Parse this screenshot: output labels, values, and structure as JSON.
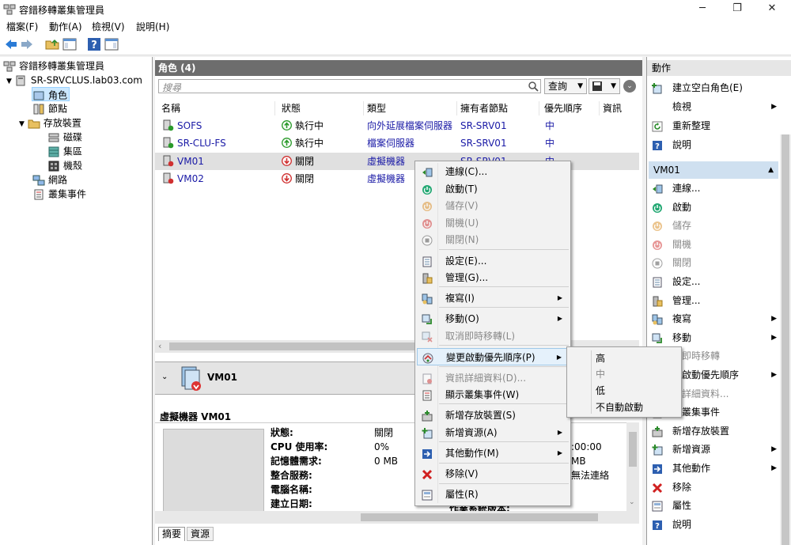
{
  "window": {
    "title": "容錯移轉叢集管理員"
  },
  "menubar": {
    "items": [
      "檔案(F)",
      "動作(A)",
      "檢視(V)",
      "說明(H)"
    ]
  },
  "tree": {
    "root": "容錯移轉叢集管理員",
    "cluster": "SR-SRVCLUS.lab03.com",
    "roles": "角色",
    "nodes": "節點",
    "storage": "存放裝置",
    "disks": "磁碟",
    "pools": "集區",
    "enclosures": "機殼",
    "networks": "網路",
    "events": "叢集事件"
  },
  "center": {
    "header": "角色 (4)",
    "search_placeholder": "搜尋",
    "query_button": "查詢",
    "columns": [
      "名稱",
      "狀態",
      "類型",
      "擁有者節點",
      "優先順序",
      "資訊"
    ],
    "rows": [
      {
        "name": "SOFS",
        "status": "執行中",
        "type": "向外延展檔案伺服器",
        "owner": "SR-SRV01",
        "priority": "中",
        "state": "running"
      },
      {
        "name": "SR-CLU-FS",
        "status": "執行中",
        "type": "檔案伺服器",
        "owner": "SR-SRV01",
        "priority": "中",
        "state": "running"
      },
      {
        "name": "VM01",
        "status": "關閉",
        "type": "虛擬機器",
        "owner": "SR-SRV01",
        "priority": "中",
        "state": "off"
      },
      {
        "name": "VM02",
        "status": "關閉",
        "type": "虛擬機器",
        "owner": "",
        "priority": "",
        "state": "off"
      }
    ],
    "detail": {
      "title": "VM01",
      "section": "虛擬機器 VM01",
      "labels": [
        "狀態:",
        "CPU 使用率:",
        "記憶體需求:",
        "整合服務:",
        "電腦名稱:",
        "建立日期:"
      ],
      "values": [
        "關閉",
        "0%",
        "0 MB",
        "",
        "",
        ""
      ],
      "right_values": [
        ":00:00",
        "MB",
        "無法連絡"
      ],
      "partial_label": "作業系統版本:",
      "tabs": [
        "摘要",
        "資源"
      ]
    }
  },
  "context_menu": {
    "items": [
      {
        "label": "連線(C)...",
        "icon": "connect-icon",
        "disabled": false,
        "submenu": false
      },
      {
        "label": "啟動(T)",
        "icon": "start-icon",
        "disabled": false,
        "submenu": false
      },
      {
        "label": "儲存(V)",
        "icon": "save-icon",
        "disabled": true,
        "submenu": false
      },
      {
        "label": "關機(U)",
        "icon": "shutdown-icon",
        "disabled": true,
        "submenu": false
      },
      {
        "label": "關閉(N)",
        "icon": "turn-off-icon",
        "disabled": true,
        "submenu": false
      },
      {
        "label": "設定(E)...",
        "icon": "settings-icon",
        "disabled": false,
        "submenu": false
      },
      {
        "label": "管理(G)...",
        "icon": "manage-icon",
        "disabled": false,
        "submenu": false
      },
      {
        "label": "複寫(I)",
        "icon": "replicate-icon",
        "disabled": false,
        "submenu": true
      },
      {
        "label": "移動(O)",
        "icon": "move-icon",
        "disabled": false,
        "submenu": true
      },
      {
        "label": "取消即時移轉(L)",
        "icon": "cancel-migration-icon",
        "disabled": true,
        "submenu": false
      },
      {
        "label": "變更啟動優先順序(P)",
        "icon": "priority-icon",
        "disabled": false,
        "submenu": true
      },
      {
        "label": "資訊詳細資料(D)...",
        "icon": "info-details-icon",
        "disabled": true,
        "submenu": false
      },
      {
        "label": "顯示叢集事件(W)",
        "icon": "events-icon",
        "disabled": false,
        "submenu": false
      },
      {
        "label": "新增存放裝置(S)",
        "icon": "add-storage-icon",
        "disabled": false,
        "submenu": false
      },
      {
        "label": "新增資源(A)",
        "icon": "add-resource-icon",
        "disabled": false,
        "submenu": true
      },
      {
        "label": "其他動作(M)",
        "icon": "more-actions-icon",
        "disabled": false,
        "submenu": true
      },
      {
        "label": "移除(V)",
        "icon": "remove-icon",
        "disabled": false,
        "submenu": false
      },
      {
        "label": "屬性(R)",
        "icon": "properties-icon",
        "disabled": false,
        "submenu": false
      }
    ]
  },
  "priority_submenu": {
    "items": [
      "高",
      "中",
      "低",
      "不自動啟動"
    ]
  },
  "actions": {
    "header": "動作",
    "general": [
      {
        "label": "建立空白角色(E)",
        "icon": "create-role-icon",
        "arrow": false
      },
      {
        "label": "檢視",
        "icon": "",
        "arrow": true
      },
      {
        "label": "重新整理",
        "icon": "refresh-icon",
        "arrow": false
      },
      {
        "label": "說明",
        "icon": "help-icon",
        "arrow": false
      }
    ],
    "vm_header": "VM01",
    "vm": [
      {
        "label": "連線...",
        "disabled": false,
        "arrow": false
      },
      {
        "label": "啟動",
        "disabled": false,
        "arrow": false
      },
      {
        "label": "儲存",
        "disabled": true,
        "arrow": false
      },
      {
        "label": "關機",
        "disabled": true,
        "arrow": false
      },
      {
        "label": "關閉",
        "disabled": true,
        "arrow": false
      },
      {
        "label": "設定...",
        "disabled": false,
        "arrow": false
      },
      {
        "label": "管理...",
        "disabled": false,
        "arrow": false
      },
      {
        "label": "複寫",
        "disabled": false,
        "arrow": true
      },
      {
        "label": "移動",
        "disabled": false,
        "arrow": true
      },
      {
        "label": "消即時移轉",
        "disabled": true,
        "arrow": false
      },
      {
        "label": "更啟動優先順序",
        "disabled": false,
        "arrow": true
      },
      {
        "label": "訊詳細資料...",
        "disabled": true,
        "arrow": false
      },
      {
        "label": "示叢集事件",
        "disabled": false,
        "arrow": false
      },
      {
        "label": "新增存放裝置",
        "disabled": false,
        "arrow": false
      },
      {
        "label": "新增資源",
        "disabled": false,
        "arrow": true
      },
      {
        "label": "其他動作",
        "disabled": false,
        "arrow": true
      },
      {
        "label": "移除",
        "disabled": false,
        "arrow": false
      },
      {
        "label": "屬性",
        "disabled": false,
        "arrow": false
      },
      {
        "label": "說明",
        "disabled": false,
        "arrow": false
      }
    ]
  }
}
